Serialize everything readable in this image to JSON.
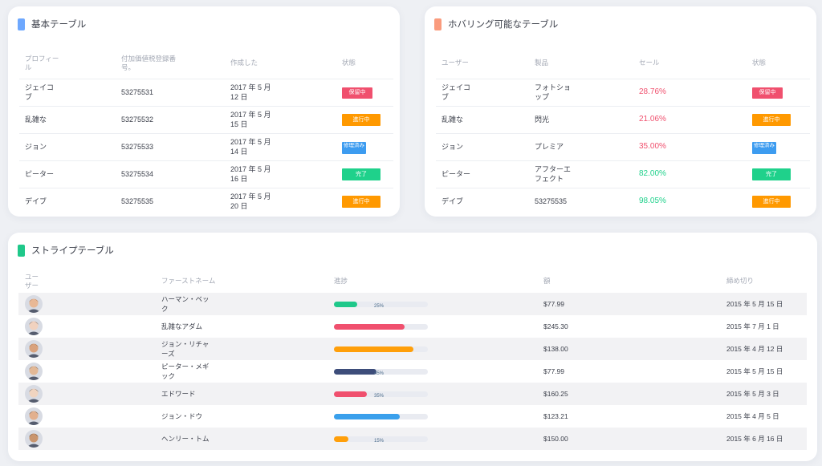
{
  "basic": {
    "title": "基本テーブル",
    "accent": "#6ea8fe",
    "columns": [
      "プロフィール",
      "付加価値税登録番号。",
      "作成した",
      "状態"
    ],
    "rows": [
      {
        "profile": "ジェイコブ",
        "vat": "53275531",
        "created": "2017 年 5 月 12 日",
        "status": "保留中",
        "color": "#f0506e"
      },
      {
        "profile": "乱雑な",
        "vat": "53275532",
        "created": "2017 年 5 月 15 日",
        "status": "進行中",
        "color": "#ff9900"
      },
      {
        "profile": "ジョン",
        "vat": "53275533",
        "created": "2017 年 5 月 14 日",
        "status": "修理済み",
        "color": "#3d9cf0"
      },
      {
        "profile": "ピーター",
        "vat": "53275534",
        "created": "2017 年 5 月 16 日",
        "status": "完了",
        "color": "#1fd18b"
      },
      {
        "profile": "デイブ",
        "vat": "53275535",
        "created": "2017 年 5 月 20 日",
        "status": "進行中",
        "color": "#ff9900"
      }
    ]
  },
  "hover": {
    "title": "ホバリング可能なテーブル",
    "accent": "#fa9b7d",
    "columns": [
      "ユーザー",
      "製品",
      "セール",
      "状態"
    ],
    "rows": [
      {
        "user": "ジェイコブ",
        "product": "フォトショップ",
        "sale": "28.76%",
        "sale_color": "#f0506e",
        "status": "保留中",
        "color": "#f0506e"
      },
      {
        "user": "乱雑な",
        "product": "閃光",
        "sale": "21.06%",
        "sale_color": "#f0506e",
        "status": "進行中",
        "color": "#ff9900"
      },
      {
        "user": "ジョン",
        "product": "プレミア",
        "sale": "35.00%",
        "sale_color": "#f0506e",
        "status": "修理済み",
        "color": "#3d9cf0"
      },
      {
        "user": "ピーター",
        "product": "アフターエフェクト",
        "sale": "82.00%",
        "sale_color": "#1fd18b",
        "status": "完了",
        "color": "#1fd18b"
      },
      {
        "user": "デイブ",
        "product": "53275535",
        "sale": "98.05%",
        "sale_color": "#1fd18b",
        "status": "進行中",
        "color": "#ff9900"
      }
    ]
  },
  "striped": {
    "title": "ストライプテーブル",
    "accent": "#1fc88a",
    "columns": [
      "ユーザー",
      "ファーストネーム",
      "進捗",
      "額",
      "締め切り"
    ],
    "rows": [
      {
        "first": "ハーマン・ベック",
        "progress": 0.25,
        "progress_label": "25%",
        "bar": "#1fc88a",
        "amount": "$77.99",
        "deadline": "2015 年 5 月 15 日",
        "skin": "#e8b896",
        "hair": "#8a4a24"
      },
      {
        "first": "乱雑なアダム",
        "progress": 0.75,
        "progress_label": "",
        "bar": "#f0506e",
        "amount": "$245.30",
        "deadline": "2015 年 7 月 1 日",
        "skin": "#f1d2bf",
        "hair": "#2a2020"
      },
      {
        "first": "ジョン・リチャーズ",
        "progress": 0.85,
        "progress_label": "",
        "bar": "#ff9f0a",
        "amount": "$138.00",
        "deadline": "2015 年 4 月 12 日",
        "skin": "#d9a27d",
        "hair": "#6b4a2a"
      },
      {
        "first": "ピーター・メギック",
        "progress": 0.45,
        "progress_label": "45%",
        "bar": "#3d4d7a",
        "amount": "$77.99",
        "deadline": "2015 年 5 月 15 日",
        "skin": "#e2b896",
        "hair": "#3a2a22"
      },
      {
        "first": "エドワード",
        "progress": 0.35,
        "progress_label": "35%",
        "bar": "#f0506e",
        "amount": "$160.25",
        "deadline": "2015 年 5 月 3 日",
        "skin": "#f0d4c0",
        "hair": "#1e1e1e"
      },
      {
        "first": "ジョン・ドウ",
        "progress": 0.7,
        "progress_label": "",
        "bar": "#3aa0ec",
        "amount": "$123.21",
        "deadline": "2015 年 4 月 5 日",
        "skin": "#e2b08e",
        "hair": "#151515"
      },
      {
        "first": "ヘンリー・トム",
        "progress": 0.15,
        "progress_label": "15%",
        "bar": "#ff9f0a",
        "amount": "$150.00",
        "deadline": "2015 年 6 月 16 日",
        "skin": "#c9956e",
        "hair": "#111111"
      }
    ]
  }
}
